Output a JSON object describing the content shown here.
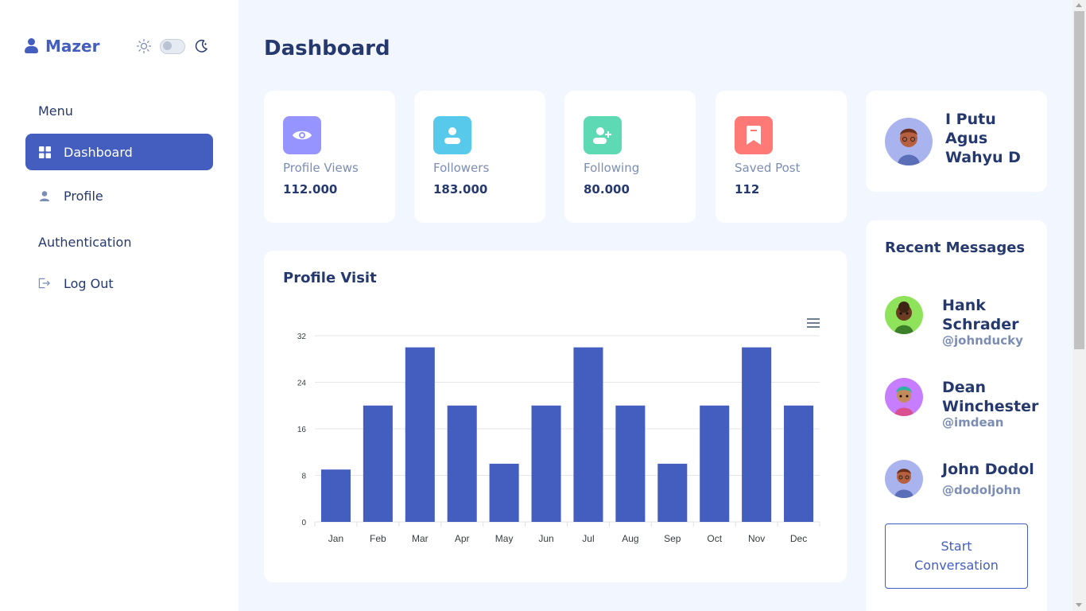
{
  "sidebar": {
    "brand": "Mazer",
    "sections": {
      "menu": "Menu",
      "auth": "Authentication"
    },
    "items": [
      {
        "label": "Dashboard",
        "icon": "grid-icon"
      },
      {
        "label": "Profile",
        "icon": "person-icon"
      },
      {
        "label": "Log Out",
        "icon": "logout-icon"
      }
    ],
    "theme": {
      "mode": "light"
    }
  },
  "main": {
    "title": "Dashboard",
    "stats": [
      {
        "label": "Profile Views",
        "value": "112.000",
        "color": "#9694ff",
        "icon": "eye-icon"
      },
      {
        "label": "Followers",
        "value": "183.000",
        "color": "#57caeb",
        "icon": "user-icon"
      },
      {
        "label": "Following",
        "value": "80.000",
        "color": "#5ddab4",
        "icon": "user-plus-icon"
      },
      {
        "label": "Saved Post",
        "value": "112",
        "color": "#ff7976",
        "icon": "bookmark-icon"
      }
    ],
    "chart_title": "Profile Visit"
  },
  "chart_data": {
    "type": "bar",
    "categories": [
      "Jan",
      "Feb",
      "Mar",
      "Apr",
      "May",
      "Jun",
      "Jul",
      "Aug",
      "Sep",
      "Oct",
      "Nov",
      "Dec"
    ],
    "values": [
      9,
      20,
      30,
      20,
      10,
      20,
      30,
      20,
      10,
      20,
      30,
      20
    ],
    "yticks": [
      "0",
      "8",
      "16",
      "24",
      "32"
    ],
    "ylim": [
      0,
      32
    ],
    "bar_color": "#435ebe",
    "grid": true
  },
  "profile": {
    "name": "I Putu Agus Wahyu D"
  },
  "messages": {
    "title": "Recent Messages",
    "items": [
      {
        "name": "Hank Schrader",
        "handle": "@johnducky",
        "avatar_color": "#8ee35b"
      },
      {
        "name": "Dean Winchester",
        "handle": "@imdean",
        "avatar_color": "#c77dff"
      },
      {
        "name": "John Dodol",
        "handle": "@dodoljohn",
        "avatar_color": "#a9b4ee"
      }
    ],
    "button": "Start Conversation"
  },
  "colors": {
    "primary": "#435ebe",
    "background": "#f2f7ff",
    "text": "#25396f",
    "muted": "#7c8db5"
  }
}
